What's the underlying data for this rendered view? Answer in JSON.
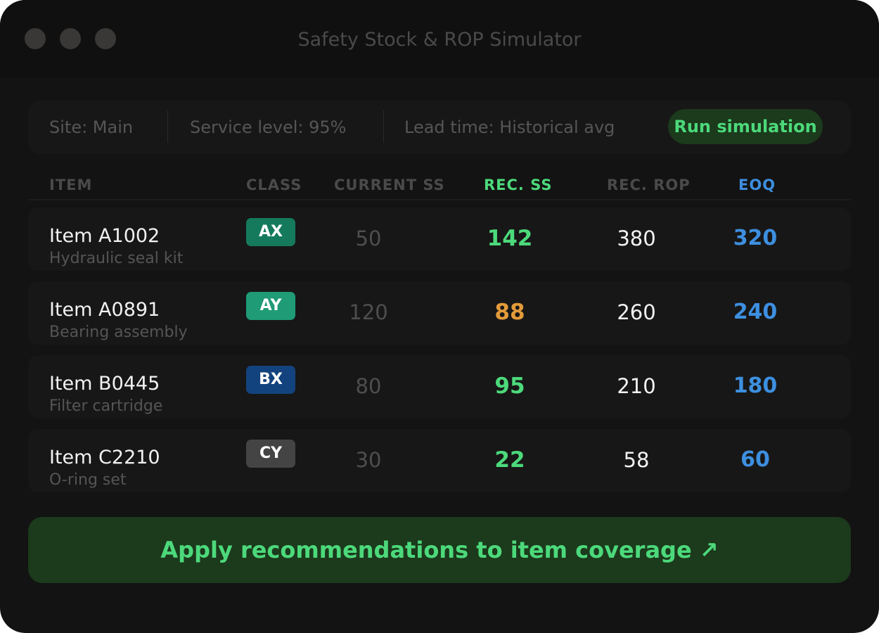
{
  "window": {
    "title": "Safety Stock & ROP Simulator",
    "traffic_light_color": "#3a3836"
  },
  "toolbar": {
    "site": "Site: Main",
    "service_level": "Service level: 95%",
    "lead_time": "Lead time: Historical avg",
    "run_label": "Run simulation"
  },
  "columns": {
    "item": "ITEM",
    "class": "CLASS",
    "current_ss": "CURRENT SS",
    "rec_ss": "REC. SS",
    "rec_rop": "REC. ROP",
    "eoq": "EOQ"
  },
  "rows": [
    {
      "name": "Item A1002",
      "desc": "Hydraulic seal kit",
      "class": "AX",
      "class_color": "#157a5c",
      "current_ss": "50",
      "rec_ss": "142",
      "rec_ss_color": "#4cd97b",
      "rec_rop": "380",
      "eoq": "320"
    },
    {
      "name": "Item A0891",
      "desc": "Bearing assembly",
      "class": "AY",
      "class_color": "#1f9b76",
      "current_ss": "120",
      "rec_ss": "88",
      "rec_ss_color": "#e39b3a",
      "rec_rop": "260",
      "eoq": "240"
    },
    {
      "name": "Item B0445",
      "desc": "Filter cartridge",
      "class": "BX",
      "class_color": "#13437e",
      "current_ss": "80",
      "rec_ss": "95",
      "rec_ss_color": "#4cd97b",
      "rec_rop": "210",
      "eoq": "180"
    },
    {
      "name": "Item C2210",
      "desc": "O-ring set",
      "class": "CY",
      "class_color": "#444444",
      "current_ss": "30",
      "rec_ss": "22",
      "rec_ss_color": "#4cd97b",
      "rec_rop": "58",
      "eoq": "60"
    }
  ],
  "apply_label": "Apply recommendations to item coverage ↗",
  "colors": {
    "accent_green": "#4cd97b",
    "accent_blue": "#3d8fe0",
    "warning_orange": "#e39b3a",
    "button_bg": "#1c3a1c"
  }
}
